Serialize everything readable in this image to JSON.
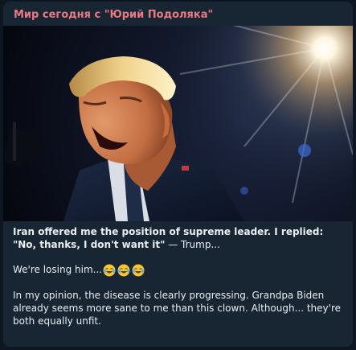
{
  "channel": {
    "name": "Мир сегодня с \"Юрий Подоляка\""
  },
  "post": {
    "image": {
      "icon": "photo-portrait"
    },
    "headline_bold": "Iran offered me the position of supreme leader. I replied: \"No, thanks, I don't want it\"",
    "headline_rest": " — Trump...",
    "line2": "We're losing him...",
    "emoji": [
      "tears-of-joy-icon",
      "tears-of-joy-icon",
      "tears-of-joy-icon"
    ],
    "line3": "In my opinion, the disease is clearly progressing. Grandpa Biden already seems more sane to me than this clown. Although... they're both equally unfit."
  },
  "colors": {
    "background": "#0e1621",
    "bubble": "#182533",
    "channel_name": "#e87a82",
    "text": "#e9eef3"
  }
}
